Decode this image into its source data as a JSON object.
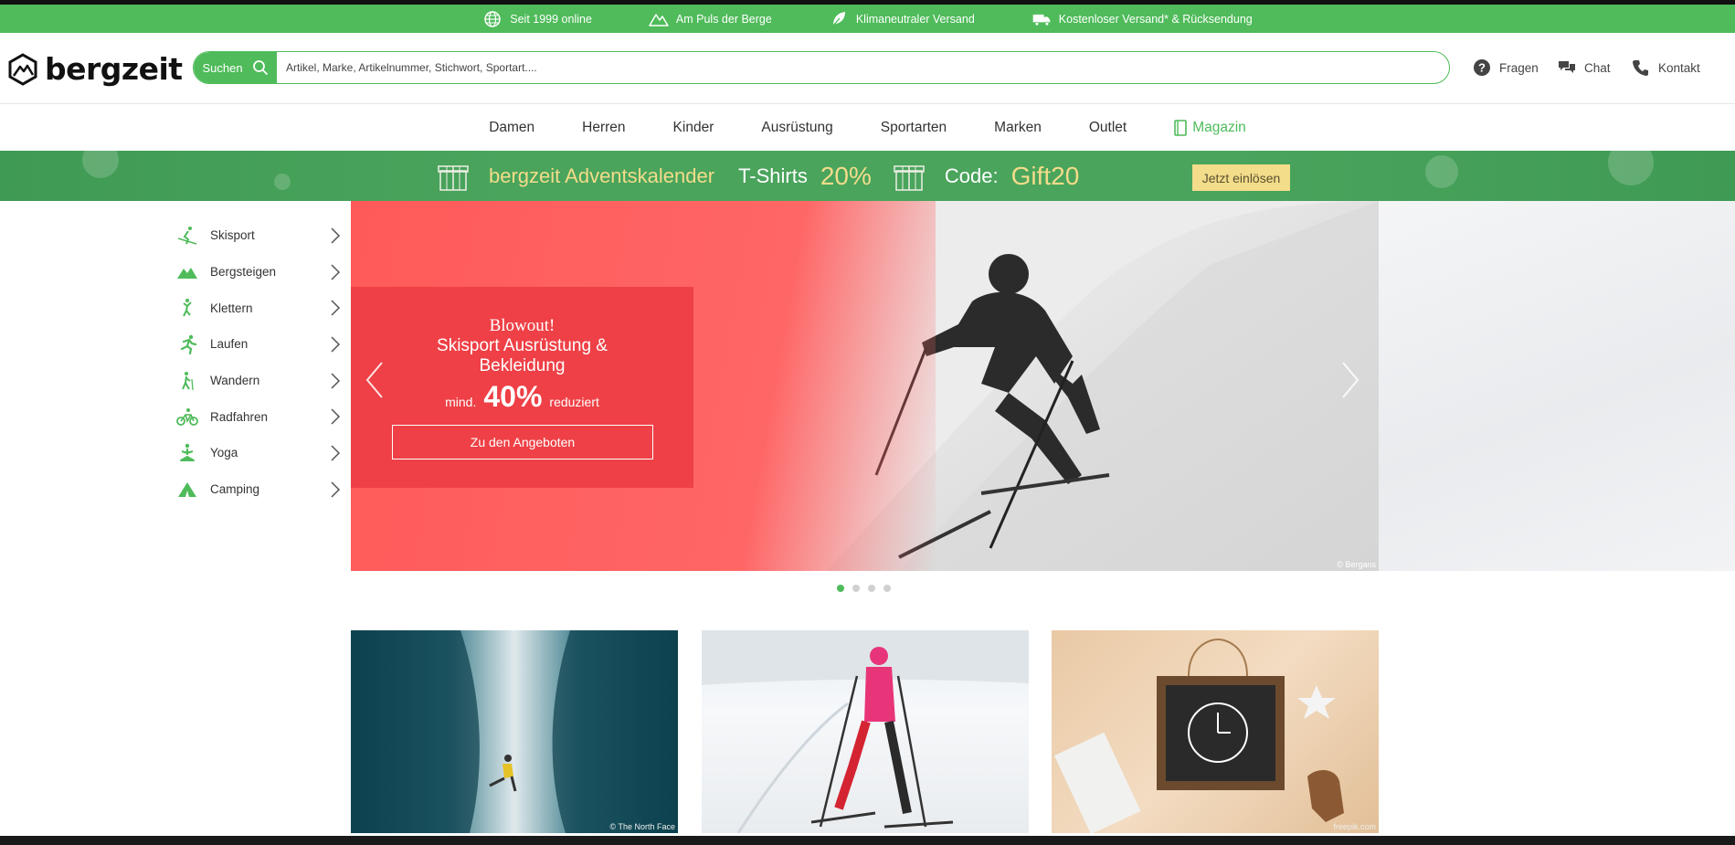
{
  "usp_bar": {
    "items": [
      {
        "icon": "globe-icon",
        "label": "Seit 1999 online"
      },
      {
        "icon": "mountain-icon",
        "label": "Am Puls der Berge"
      },
      {
        "icon": "leaf-icon",
        "label": "Klimaneutraler Versand"
      },
      {
        "icon": "truck-icon",
        "label": "Kostenloser Versand* & Rücksendung"
      }
    ]
  },
  "header": {
    "logo_text": "bergzeit",
    "search": {
      "button_label": "Suchen",
      "placeholder": "Artikel, Marke, Artikelnummer, Stichwort, Sportart...."
    },
    "services": [
      {
        "icon": "question-icon",
        "label": "Fragen"
      },
      {
        "icon": "chat-icon",
        "label": "Chat"
      },
      {
        "icon": "phone-icon",
        "label": "Kontakt"
      }
    ]
  },
  "nav": {
    "items": [
      "Damen",
      "Herren",
      "Kinder",
      "Ausrüstung",
      "Sportarten",
      "Marken",
      "Outlet"
    ],
    "magazine": "Magazin"
  },
  "promo": {
    "title": "bergzeit Adventskalender",
    "product": "T-Shirts",
    "discount": "20%",
    "code_label": "Code:",
    "code": "Gift20",
    "button": "Jetzt einlösen"
  },
  "sidebar": {
    "items": [
      {
        "icon": "ski-icon",
        "label": "Skisport"
      },
      {
        "icon": "mountain-icon",
        "label": "Bergsteigen"
      },
      {
        "icon": "climbing-icon",
        "label": "Klettern"
      },
      {
        "icon": "running-icon",
        "label": "Laufen"
      },
      {
        "icon": "hiking-icon",
        "label": "Wandern"
      },
      {
        "icon": "bike-icon",
        "label": "Radfahren"
      },
      {
        "icon": "yoga-icon",
        "label": "Yoga"
      },
      {
        "icon": "tent-icon",
        "label": "Camping"
      }
    ]
  },
  "hero": {
    "headline": "Blowout!",
    "subline": "Skisport Ausrüstung & Bekleidung",
    "prefix": "mind.",
    "discount": "40%",
    "suffix": "reduziert",
    "cta": "Zu den Angeboten",
    "credit": "© Bergans",
    "active_slide": 1,
    "slide_count": 4
  },
  "tiles": [
    {
      "credit": "© The North Face"
    },
    {
      "credit": ""
    },
    {
      "credit": "freepik.com"
    }
  ],
  "colors": {
    "brand_green": "#4fbb5a",
    "promo_green": "#4aa45c",
    "gold": "#f3dc8a",
    "hero_red": "#ee4046"
  }
}
